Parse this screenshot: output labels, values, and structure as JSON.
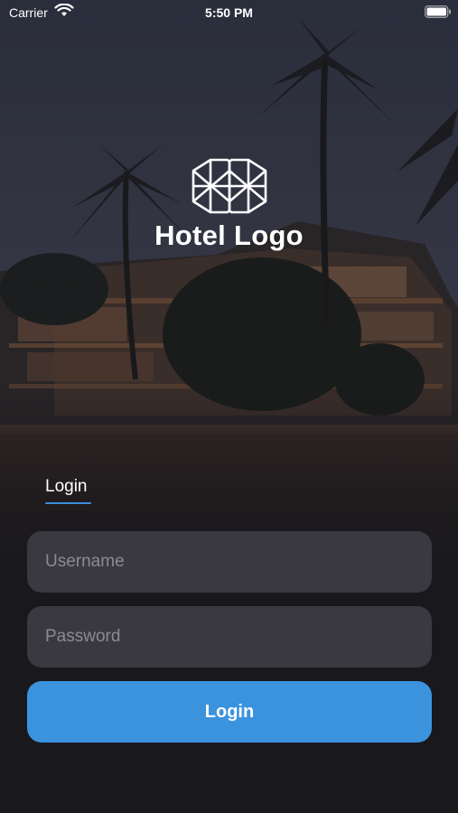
{
  "status_bar": {
    "carrier": "Carrier",
    "time": "5:50 PM",
    "wifi_icon": "wifi-icon",
    "battery_icon": "battery-icon"
  },
  "logo": {
    "icon": "hexagon-lattice-logo-icon",
    "text": "Hotel Logo"
  },
  "tabs": [
    {
      "label": "Login",
      "active": true
    }
  ],
  "form": {
    "username_placeholder": "Username",
    "username_value": "",
    "password_placeholder": "Password",
    "password_value": "",
    "login_button_label": "Login"
  },
  "colors": {
    "accent": "#3b93dd",
    "field_background": "#3a393f",
    "background": "#18181d"
  }
}
